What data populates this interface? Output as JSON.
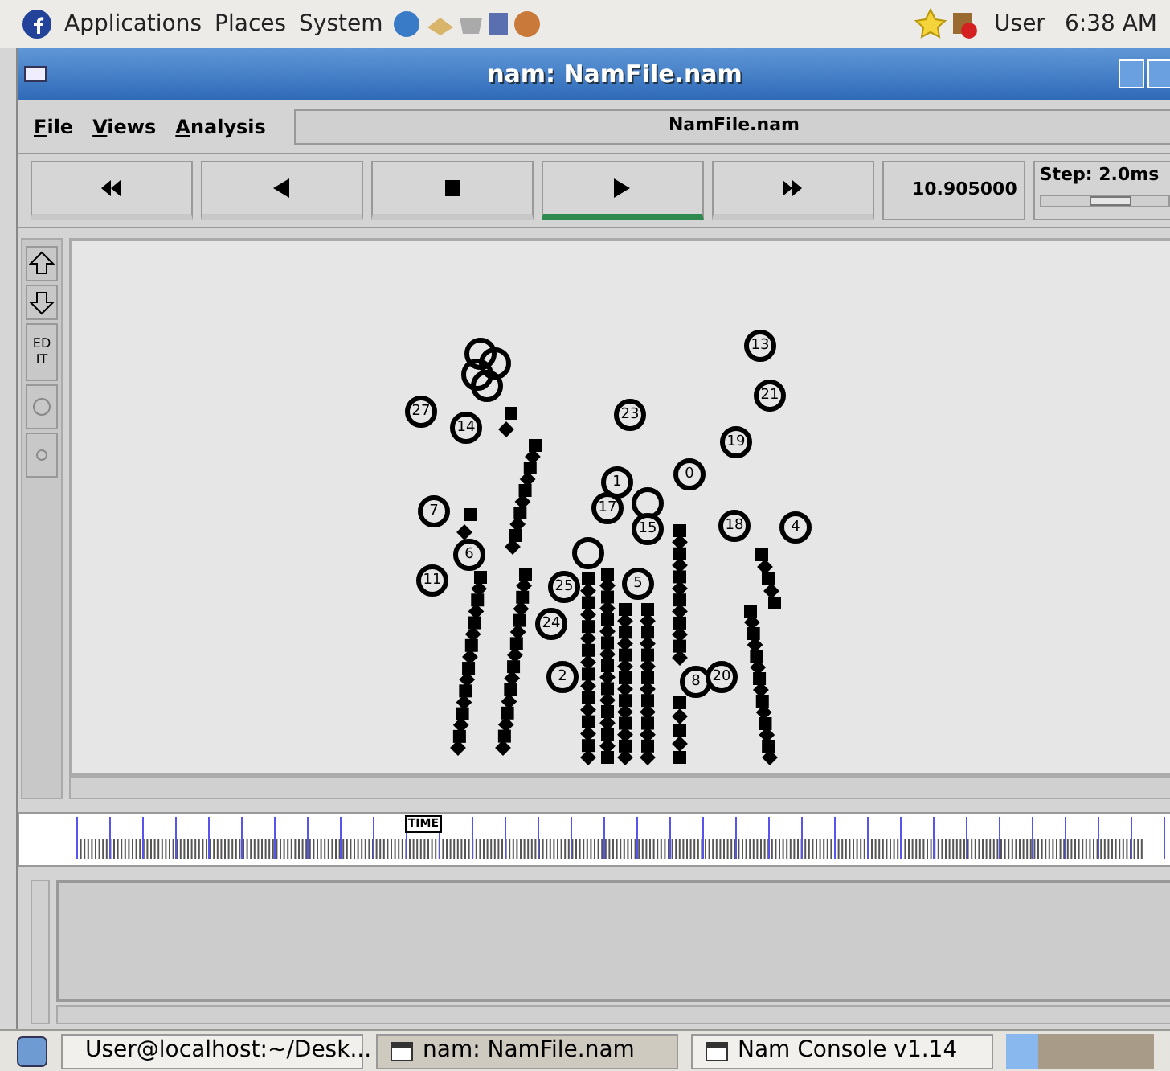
{
  "top_panel": {
    "menus": [
      "Applications",
      "Places",
      "System"
    ],
    "user": "User",
    "clock": "6:38 AM"
  },
  "window": {
    "title": "nam: NamFile.nam"
  },
  "menu_bar": {
    "items": [
      "File",
      "Views",
      "Analysis"
    ],
    "file_name": "NamFile.nam"
  },
  "controls": [
    {
      "kind": "fast-rewind",
      "selected": false
    },
    {
      "kind": "back",
      "selected": false
    },
    {
      "kind": "stop",
      "selected": false
    },
    {
      "kind": "play",
      "selected": true
    },
    {
      "kind": "fast-forward",
      "selected": false
    }
  ],
  "time": "10.905000",
  "step": {
    "label": "Step: 2.0ms",
    "level": 0.55
  },
  "side_tools": {
    "edit_lines": [
      "ED",
      "IT"
    ]
  },
  "nodes": [
    "13",
    "21",
    "23",
    "19",
    "0",
    "1",
    "17",
    "15",
    "18",
    "4",
    "25",
    "5",
    "24",
    "2",
    "8",
    "20",
    "27",
    "14",
    "7",
    "6",
    "11"
  ],
  "timeline": {
    "label": "TIME",
    "level": 0.33
  },
  "taskbar": [
    {
      "label": "User@localhost:~/Desk...",
      "selected": false
    },
    {
      "label": "nam: NamFile.nam",
      "selected": true
    },
    {
      "label": "Nam Console v1.14",
      "selected": false
    }
  ]
}
